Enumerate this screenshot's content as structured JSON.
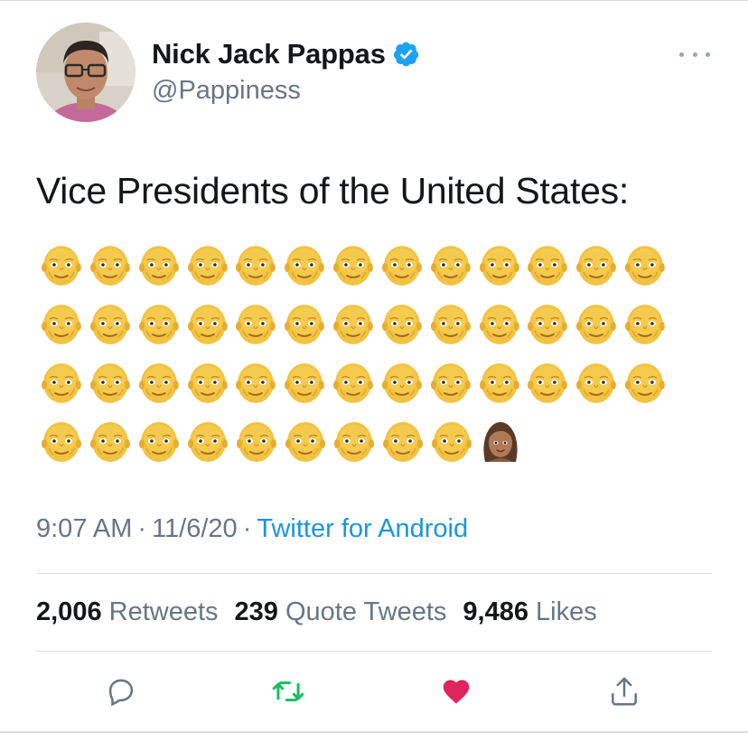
{
  "author": {
    "display_name": "Nick Jack Pappas",
    "handle": "@Pappiness",
    "verified": true
  },
  "tweet": {
    "text": "Vice Presidents of the United States:",
    "emoji_rows": [
      [
        "older-man",
        "older-man",
        "older-man",
        "older-man",
        "older-man",
        "older-man",
        "older-man",
        "older-man",
        "older-man",
        "older-man",
        "older-man",
        "older-man",
        "older-man"
      ],
      [
        "older-man",
        "older-man",
        "older-man",
        "older-man",
        "older-man",
        "older-man",
        "older-man",
        "older-man",
        "older-man",
        "older-man",
        "older-man",
        "older-man",
        "older-man"
      ],
      [
        "older-man",
        "older-man",
        "older-man",
        "older-man",
        "older-man",
        "older-man",
        "older-man",
        "older-man",
        "older-man",
        "older-man",
        "older-man",
        "older-man",
        "older-man"
      ],
      [
        "older-man",
        "older-man",
        "older-man",
        "older-man",
        "older-man",
        "older-man",
        "older-man",
        "older-man",
        "older-man",
        "woman-medium-dark-skin"
      ]
    ],
    "time": "9:07 AM",
    "date": "11/6/20",
    "source": "Twitter for Android"
  },
  "stats": {
    "retweets_count": "2,006",
    "retweets_label": "Retweets",
    "quotes_count": "239",
    "quotes_label": "Quote Tweets",
    "likes_count": "9,486",
    "likes_label": "Likes"
  },
  "actions": {
    "reply_icon": "reply-icon",
    "retweet_icon": "retweet-icon",
    "like_icon": "heart-icon",
    "share_icon": "share-icon"
  },
  "colors": {
    "link": "#1b95e0",
    "secondary_text": "#657786",
    "retweet_green": "#17bf63",
    "like_red": "#e0245e",
    "verified_blue": "#1da1f2"
  }
}
